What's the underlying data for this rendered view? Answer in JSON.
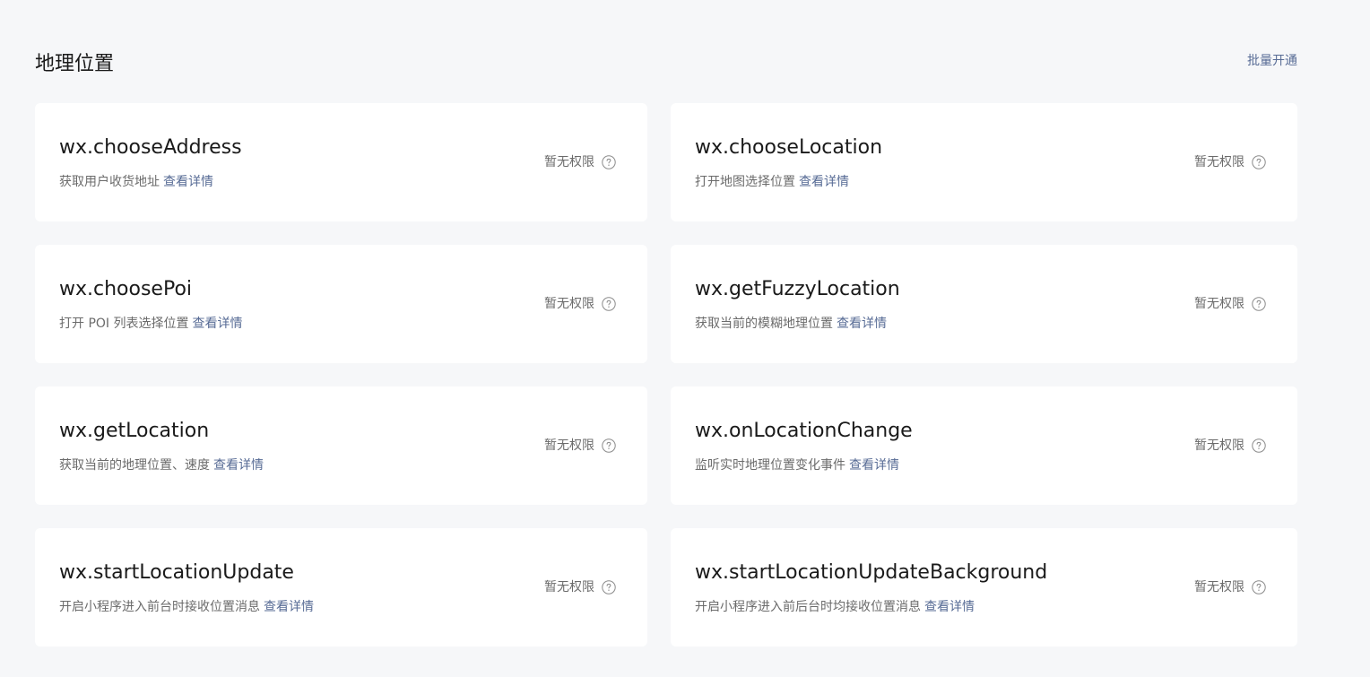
{
  "section": {
    "title": "地理位置",
    "bulk_action_label": "批量开通"
  },
  "cards": [
    {
      "api": "wx.chooseAddress",
      "description": "获取用户收货地址",
      "detail_label": "查看详情",
      "permission_status": "暂无权限",
      "help_icon": "question-circle-icon"
    },
    {
      "api": "wx.chooseLocation",
      "description": "打开地图选择位置",
      "detail_label": "查看详情",
      "permission_status": "暂无权限",
      "help_icon": "question-circle-icon"
    },
    {
      "api": "wx.choosePoi",
      "description": "打开 POI 列表选择位置",
      "detail_label": "查看详情",
      "permission_status": "暂无权限",
      "help_icon": "question-circle-icon"
    },
    {
      "api": "wx.getFuzzyLocation",
      "description": "获取当前的模糊地理位置",
      "detail_label": "查看详情",
      "permission_status": "暂无权限",
      "help_icon": "question-circle-icon"
    },
    {
      "api": "wx.getLocation",
      "description": "获取当前的地理位置、速度",
      "detail_label": "查看详情",
      "permission_status": "暂无权限",
      "help_icon": "question-circle-icon"
    },
    {
      "api": "wx.onLocationChange",
      "description": "监听实时地理位置变化事件",
      "detail_label": "查看详情",
      "permission_status": "暂无权限",
      "help_icon": "question-circle-icon"
    },
    {
      "api": "wx.startLocationUpdate",
      "description": "开启小程序进入前台时接收位置消息",
      "detail_label": "查看详情",
      "permission_status": "暂无权限",
      "help_icon": "question-circle-icon"
    },
    {
      "api": "wx.startLocationUpdateBackground",
      "description": "开启小程序进入前后台时均接收位置消息",
      "detail_label": "查看详情",
      "permission_status": "暂无权限",
      "help_icon": "question-circle-icon"
    }
  ],
  "colors": {
    "page_background": "#f6f7f9",
    "card_background": "#ffffff",
    "link": "#576b95",
    "muted_text": "#6b6b6b",
    "primary_text": "#1a1a1a"
  }
}
